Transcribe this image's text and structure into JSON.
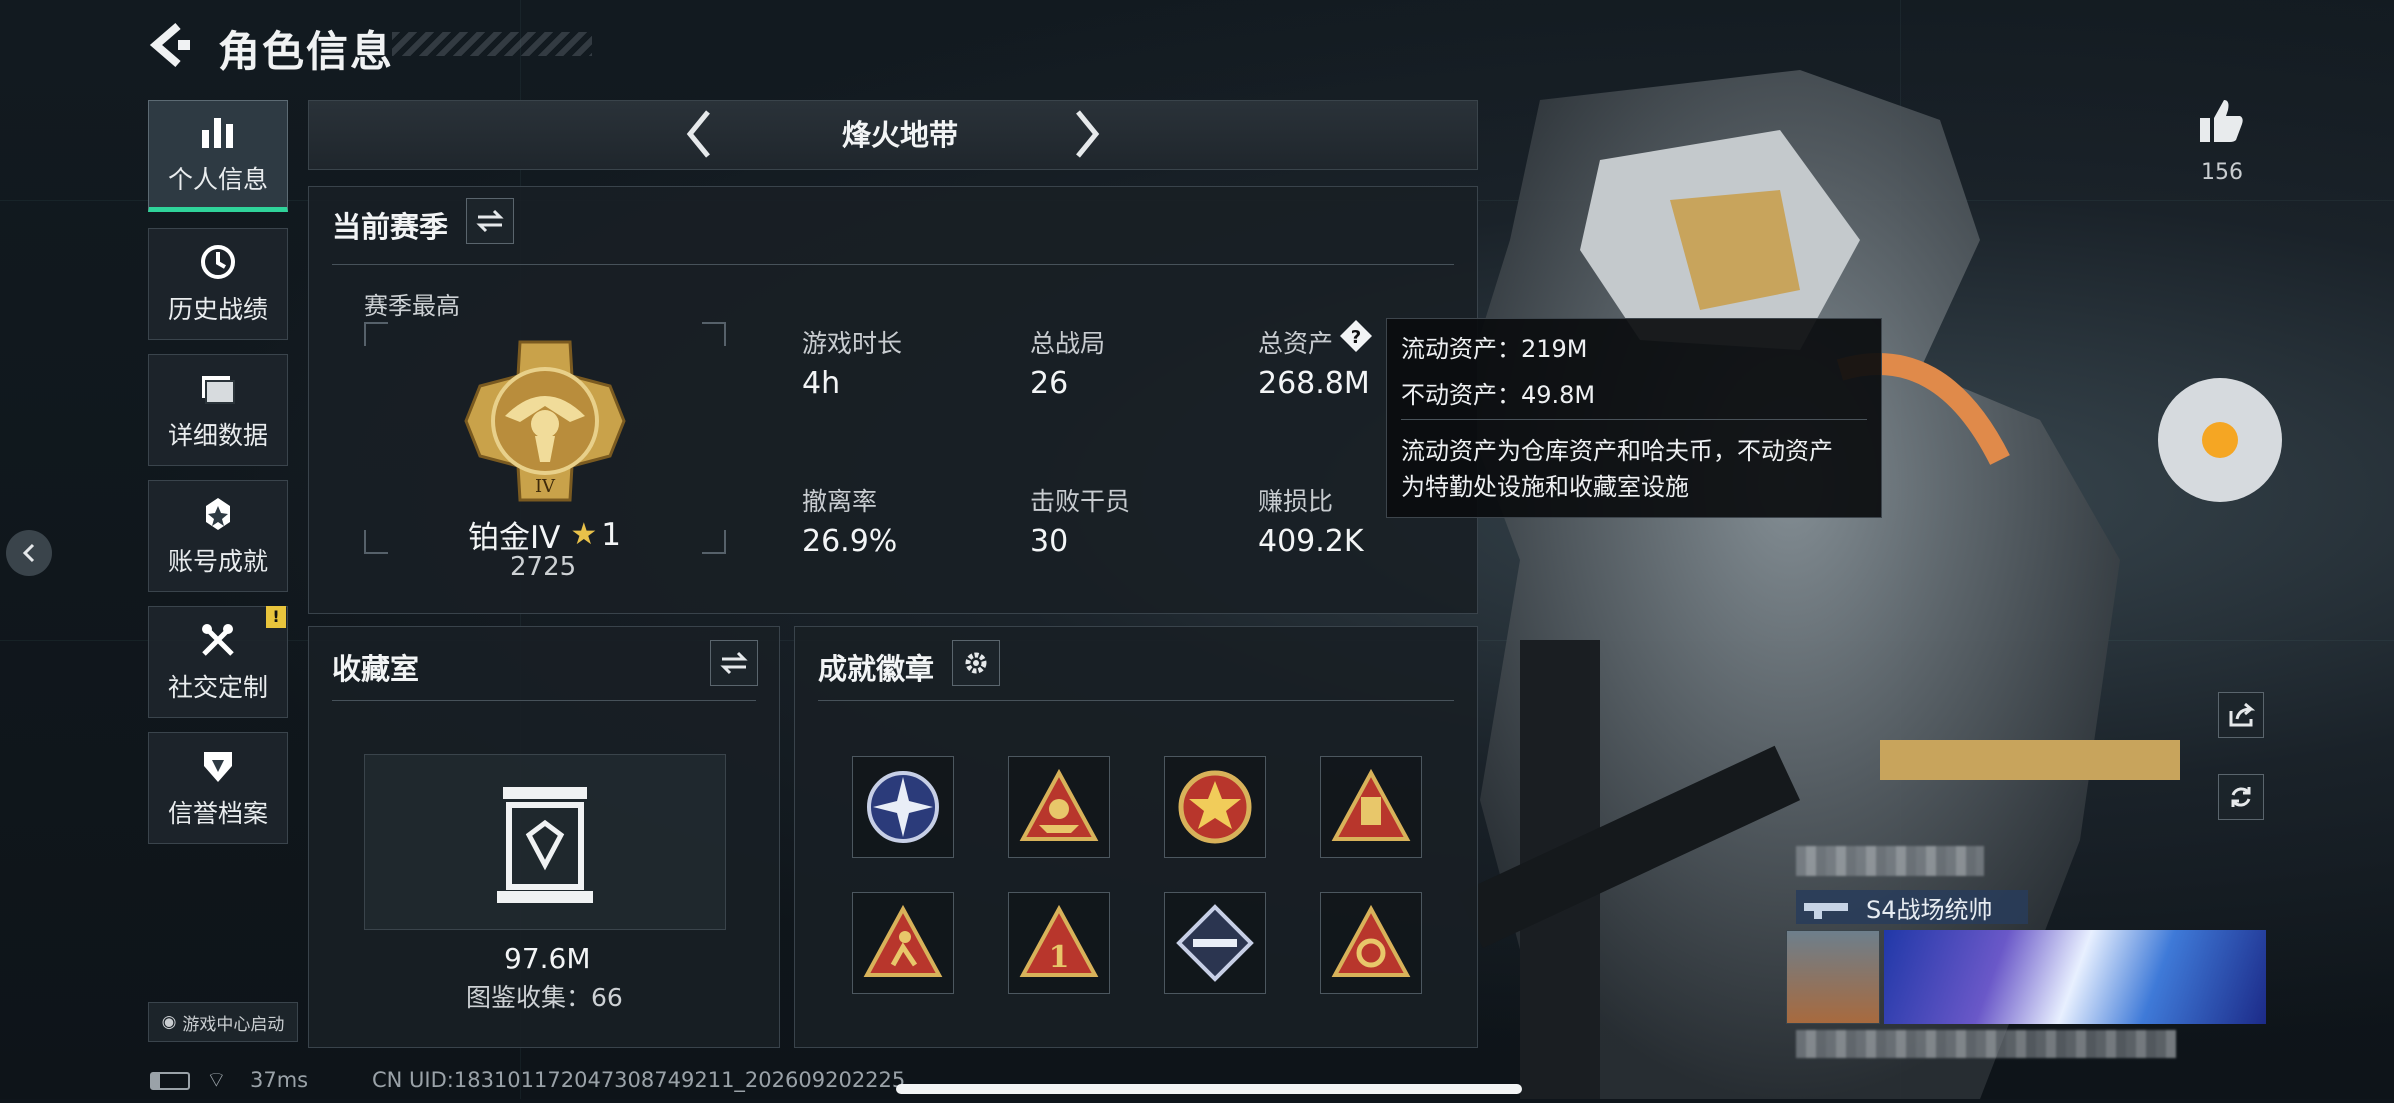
{
  "header": {
    "title": "角色信息"
  },
  "nav": {
    "items": [
      {
        "label": "个人信息",
        "icon": "bar-chart-icon",
        "active": true
      },
      {
        "label": "历史战绩",
        "icon": "history-clock-icon"
      },
      {
        "label": "详细数据",
        "icon": "folder-icon"
      },
      {
        "label": "账号成就",
        "icon": "achievement-icon"
      },
      {
        "label": "社交定制",
        "icon": "tools-icon",
        "badge": "!"
      },
      {
        "label": "信誉档案",
        "icon": "credit-shield-icon"
      }
    ],
    "game_center_label": "游戏中心启动"
  },
  "map_selector": {
    "title": "烽火地带"
  },
  "season": {
    "title": "当前赛季",
    "best_label": "赛季最高",
    "rank_name": "铂金IV",
    "rank_stars": "1",
    "rank_points": "2725",
    "rank_numeral": "IV",
    "stats": [
      {
        "label": "游戏时长",
        "value": "4h"
      },
      {
        "label": "总战局",
        "value": "26"
      },
      {
        "label": "总资产",
        "value": "268.8M"
      },
      {
        "label": "撤离率",
        "value": "26.9%"
      },
      {
        "label": "击败干员",
        "value": "30"
      },
      {
        "label": "赚损比",
        "value": "409.2K"
      }
    ]
  },
  "tooltip": {
    "line1": "流动资产：219M",
    "line2": "不动资产：49.8M",
    "desc1": "流动资产为仓库资产和哈夫币，不动资产",
    "desc2": "为特勤处设施和收藏室设施"
  },
  "collection": {
    "title": "收藏室",
    "value": "97.6M",
    "catalog": "图鉴收集：66"
  },
  "achievements": {
    "title": "成就徽章",
    "badges": [
      "compass-badge-icon",
      "boat-triangle-badge-icon",
      "star-emblem-badge-icon",
      "backpack-triangle-badge-icon",
      "runner-triangle-badge-icon",
      "number-one-triangle-badge-icon",
      "rifle-diamond-badge-icon",
      "gear-triangle-badge-icon"
    ]
  },
  "right_panel": {
    "likes": "156",
    "title_badge": "S4战场统帅"
  },
  "status_bar": {
    "ping": "37ms",
    "uid": "CN UID:18310117204730874921​1_202609202225"
  },
  "colors": {
    "accent": "#2fd39a",
    "gold": "#c9a24a",
    "badge_red": "#c0392b"
  }
}
